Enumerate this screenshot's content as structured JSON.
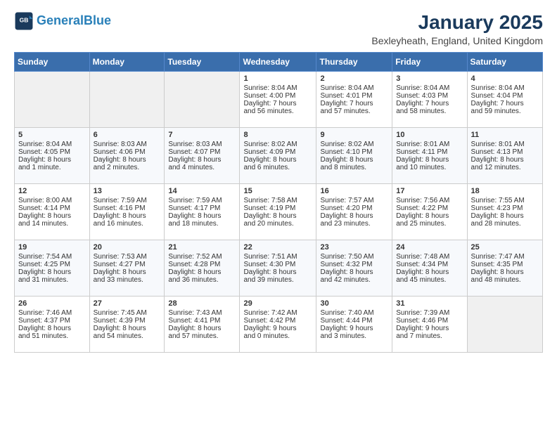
{
  "header": {
    "logo_line1": "General",
    "logo_line2": "Blue",
    "month": "January 2025",
    "location": "Bexleyheath, England, United Kingdom"
  },
  "days_of_week": [
    "Sunday",
    "Monday",
    "Tuesday",
    "Wednesday",
    "Thursday",
    "Friday",
    "Saturday"
  ],
  "weeks": [
    [
      {
        "day": "",
        "content": ""
      },
      {
        "day": "",
        "content": ""
      },
      {
        "day": "",
        "content": ""
      },
      {
        "day": "1",
        "content": "Sunrise: 8:04 AM\nSunset: 4:00 PM\nDaylight: 7 hours\nand 56 minutes."
      },
      {
        "day": "2",
        "content": "Sunrise: 8:04 AM\nSunset: 4:01 PM\nDaylight: 7 hours\nand 57 minutes."
      },
      {
        "day": "3",
        "content": "Sunrise: 8:04 AM\nSunset: 4:03 PM\nDaylight: 7 hours\nand 58 minutes."
      },
      {
        "day": "4",
        "content": "Sunrise: 8:04 AM\nSunset: 4:04 PM\nDaylight: 7 hours\nand 59 minutes."
      }
    ],
    [
      {
        "day": "5",
        "content": "Sunrise: 8:04 AM\nSunset: 4:05 PM\nDaylight: 8 hours\nand 1 minute."
      },
      {
        "day": "6",
        "content": "Sunrise: 8:03 AM\nSunset: 4:06 PM\nDaylight: 8 hours\nand 2 minutes."
      },
      {
        "day": "7",
        "content": "Sunrise: 8:03 AM\nSunset: 4:07 PM\nDaylight: 8 hours\nand 4 minutes."
      },
      {
        "day": "8",
        "content": "Sunrise: 8:02 AM\nSunset: 4:09 PM\nDaylight: 8 hours\nand 6 minutes."
      },
      {
        "day": "9",
        "content": "Sunrise: 8:02 AM\nSunset: 4:10 PM\nDaylight: 8 hours\nand 8 minutes."
      },
      {
        "day": "10",
        "content": "Sunrise: 8:01 AM\nSunset: 4:11 PM\nDaylight: 8 hours\nand 10 minutes."
      },
      {
        "day": "11",
        "content": "Sunrise: 8:01 AM\nSunset: 4:13 PM\nDaylight: 8 hours\nand 12 minutes."
      }
    ],
    [
      {
        "day": "12",
        "content": "Sunrise: 8:00 AM\nSunset: 4:14 PM\nDaylight: 8 hours\nand 14 minutes."
      },
      {
        "day": "13",
        "content": "Sunrise: 7:59 AM\nSunset: 4:16 PM\nDaylight: 8 hours\nand 16 minutes."
      },
      {
        "day": "14",
        "content": "Sunrise: 7:59 AM\nSunset: 4:17 PM\nDaylight: 8 hours\nand 18 minutes."
      },
      {
        "day": "15",
        "content": "Sunrise: 7:58 AM\nSunset: 4:19 PM\nDaylight: 8 hours\nand 20 minutes."
      },
      {
        "day": "16",
        "content": "Sunrise: 7:57 AM\nSunset: 4:20 PM\nDaylight: 8 hours\nand 23 minutes."
      },
      {
        "day": "17",
        "content": "Sunrise: 7:56 AM\nSunset: 4:22 PM\nDaylight: 8 hours\nand 25 minutes."
      },
      {
        "day": "18",
        "content": "Sunrise: 7:55 AM\nSunset: 4:23 PM\nDaylight: 8 hours\nand 28 minutes."
      }
    ],
    [
      {
        "day": "19",
        "content": "Sunrise: 7:54 AM\nSunset: 4:25 PM\nDaylight: 8 hours\nand 31 minutes."
      },
      {
        "day": "20",
        "content": "Sunrise: 7:53 AM\nSunset: 4:27 PM\nDaylight: 8 hours\nand 33 minutes."
      },
      {
        "day": "21",
        "content": "Sunrise: 7:52 AM\nSunset: 4:28 PM\nDaylight: 8 hours\nand 36 minutes."
      },
      {
        "day": "22",
        "content": "Sunrise: 7:51 AM\nSunset: 4:30 PM\nDaylight: 8 hours\nand 39 minutes."
      },
      {
        "day": "23",
        "content": "Sunrise: 7:50 AM\nSunset: 4:32 PM\nDaylight: 8 hours\nand 42 minutes."
      },
      {
        "day": "24",
        "content": "Sunrise: 7:48 AM\nSunset: 4:34 PM\nDaylight: 8 hours\nand 45 minutes."
      },
      {
        "day": "25",
        "content": "Sunrise: 7:47 AM\nSunset: 4:35 PM\nDaylight: 8 hours\nand 48 minutes."
      }
    ],
    [
      {
        "day": "26",
        "content": "Sunrise: 7:46 AM\nSunset: 4:37 PM\nDaylight: 8 hours\nand 51 minutes."
      },
      {
        "day": "27",
        "content": "Sunrise: 7:45 AM\nSunset: 4:39 PM\nDaylight: 8 hours\nand 54 minutes."
      },
      {
        "day": "28",
        "content": "Sunrise: 7:43 AM\nSunset: 4:41 PM\nDaylight: 8 hours\nand 57 minutes."
      },
      {
        "day": "29",
        "content": "Sunrise: 7:42 AM\nSunset: 4:42 PM\nDaylight: 9 hours\nand 0 minutes."
      },
      {
        "day": "30",
        "content": "Sunrise: 7:40 AM\nSunset: 4:44 PM\nDaylight: 9 hours\nand 3 minutes."
      },
      {
        "day": "31",
        "content": "Sunrise: 7:39 AM\nSunset: 4:46 PM\nDaylight: 9 hours\nand 7 minutes."
      },
      {
        "day": "",
        "content": ""
      }
    ]
  ]
}
